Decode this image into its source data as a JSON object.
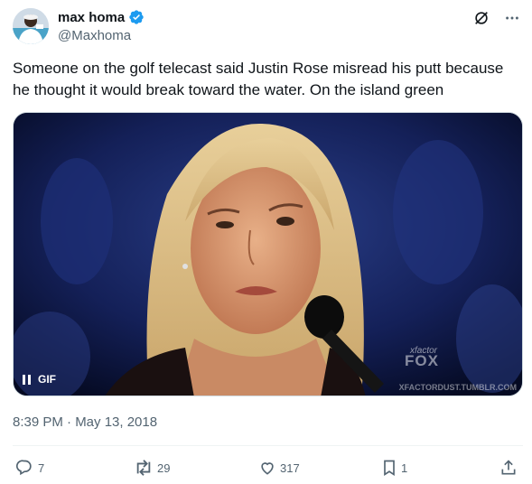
{
  "author": {
    "display_name": "max homa",
    "handle": "@Maxhoma",
    "verified": true
  },
  "tweet": {
    "text": "Someone on the golf telecast said Justin Rose misread his putt because he thought it would break toward the water. On the island green",
    "timestamp": "8:39 PM · May 13, 2018"
  },
  "media": {
    "type_label": "GIF",
    "watermark_line1": "xfactor",
    "watermark_line2": "FOX",
    "watermark_line3": "XFACTORDUST.TUMBLR.COM"
  },
  "stats": {
    "replies": "7",
    "reposts": "29",
    "likes": "317",
    "bookmarks": "1"
  },
  "icons": {
    "top": [
      "grok-icon",
      "more-icon"
    ],
    "actions": [
      "reply-icon",
      "repost-icon",
      "like-icon",
      "bookmark-icon",
      "share-icon"
    ]
  },
  "colors": {
    "text": "#0f1419",
    "secondary": "#536471",
    "verified": "#1d9bf0"
  }
}
